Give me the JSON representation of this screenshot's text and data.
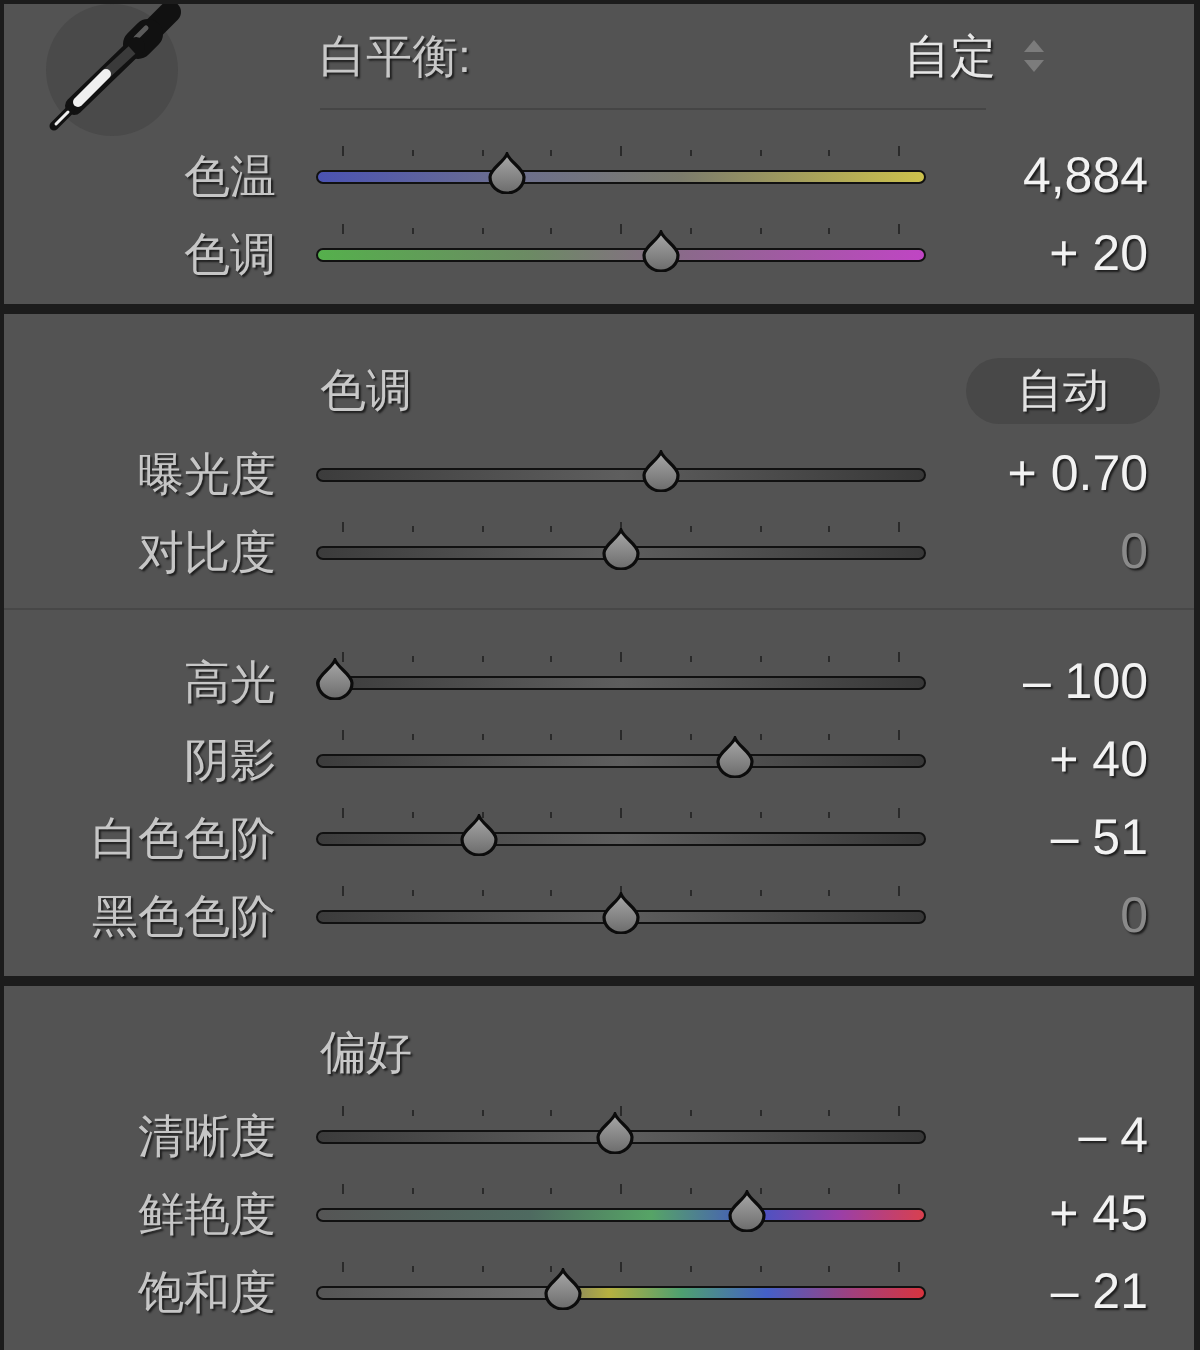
{
  "panels": [
    {
      "kind": "white_balance",
      "title": "白平衡:",
      "preset": "自定",
      "groups": [
        {
          "sliders": [
            {
              "label": "色温",
              "kind": "temperature",
              "ticks": true,
              "level": 0.3,
              "value": "4,884",
              "dimmed": false
            },
            {
              "label": "色调",
              "kind": "tint",
              "ticks": true,
              "level": 0.57,
              "value": "+ 20",
              "dimmed": false
            }
          ]
        }
      ]
    },
    {
      "kind": "tone",
      "title": "色调",
      "button": "自动",
      "groups": [
        {
          "sliders": [
            {
              "label": "曝光度",
              "kind": "plain",
              "ticks": false,
              "level": 0.57,
              "value": "+ 0.70",
              "dimmed": false
            },
            {
              "label": "对比度",
              "kind": "plain",
              "ticks": true,
              "level": 0.5,
              "value": "0",
              "dimmed": true
            }
          ]
        },
        {
          "sliders": [
            {
              "label": "高光",
              "kind": "plain",
              "ticks": true,
              "level": 0,
              "value": "– 100",
              "dimmed": false
            },
            {
              "label": "阴影",
              "kind": "plain",
              "ticks": true,
              "level": 0.7,
              "value": "+ 40",
              "dimmed": false
            },
            {
              "label": "白色色阶",
              "kind": "plain",
              "ticks": true,
              "level": 0.25,
              "value": "– 51",
              "dimmed": false
            },
            {
              "label": "黑色色阶",
              "kind": "plain",
              "ticks": true,
              "level": 0.5,
              "value": "0",
              "dimmed": true
            }
          ]
        }
      ]
    },
    {
      "kind": "presence",
      "title": "偏好",
      "groups": [
        {
          "sliders": [
            {
              "label": "清晰度",
              "kind": "plain",
              "ticks": true,
              "level": 0.49,
              "value": "– 4",
              "dimmed": false
            },
            {
              "label": "鲜艳度",
              "kind": "vibrance",
              "ticks": true,
              "level": 0.72,
              "value": "+ 45",
              "dimmed": false
            },
            {
              "label": "饱和度",
              "kind": "saturation",
              "ticks": true,
              "level": 0.4,
              "value": "– 21",
              "dimmed": false
            }
          ]
        }
      ]
    }
  ]
}
